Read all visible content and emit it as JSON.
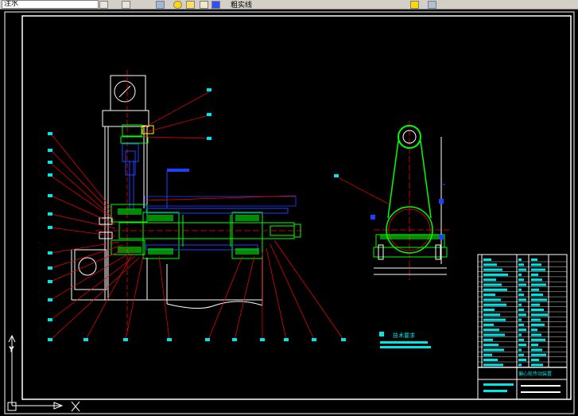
{
  "toolbar": {
    "layer_combo_value": "注水",
    "layer_state_text": "粗实线"
  },
  "drawing": {
    "tech_requirements_label": "技术要求",
    "title_block_name": "偏心轮传动装置"
  },
  "colors": {
    "background": "#000000",
    "frame": "#ffffff",
    "green": "#00ff00",
    "red": "#ff0000",
    "blue": "#2040ff",
    "cyan": "#00e5e5",
    "yellow": "#ffff00",
    "gray": "#c0c0c0"
  },
  "icons": [
    "layer-combo-dropdown-icon",
    "layer-props-icon",
    "view-icon",
    "light-bulb-icon",
    "sun-icon",
    "lock-icon",
    "color-swatch-icon",
    "match-props-icon",
    "ucs-icon"
  ]
}
